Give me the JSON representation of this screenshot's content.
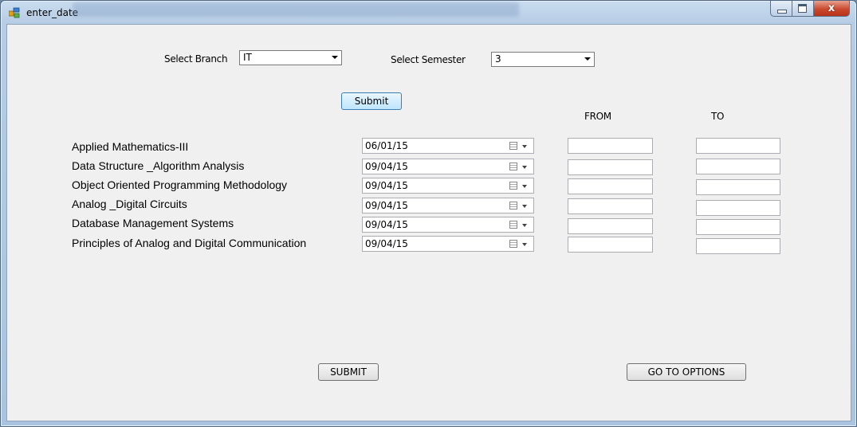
{
  "window": {
    "title": "enter_date",
    "close_label": "x"
  },
  "filters": {
    "branch_label": "Select Branch",
    "branch_value": "IT",
    "semester_label": "Select Semester",
    "semester_value": "3",
    "submit_label": "Submit"
  },
  "columns": {
    "from": "FROM",
    "to": "TO"
  },
  "subjects": [
    {
      "name": "Applied Mathematics-III",
      "date": "06/01/15"
    },
    {
      "name": "Data Structure _Algorithm Analysis",
      "date": "09/04/15"
    },
    {
      "name": "Object Oriented Programming Methodology",
      "date": "09/04/15"
    },
    {
      "name": "Analog _Digital Circuits",
      "date": "09/04/15"
    },
    {
      "name": "Database Management Systems",
      "date": "09/04/15"
    },
    {
      "name": "Principles of Analog and Digital Communication",
      "date": "09/04/15"
    }
  ],
  "actions": {
    "submit_label": "SUBMIT",
    "options_label": "GO TO OPTIONS"
  },
  "icons": {
    "app": "app-icon",
    "calendar": "calendar-icon",
    "dropdown": "chevron-down-icon"
  }
}
